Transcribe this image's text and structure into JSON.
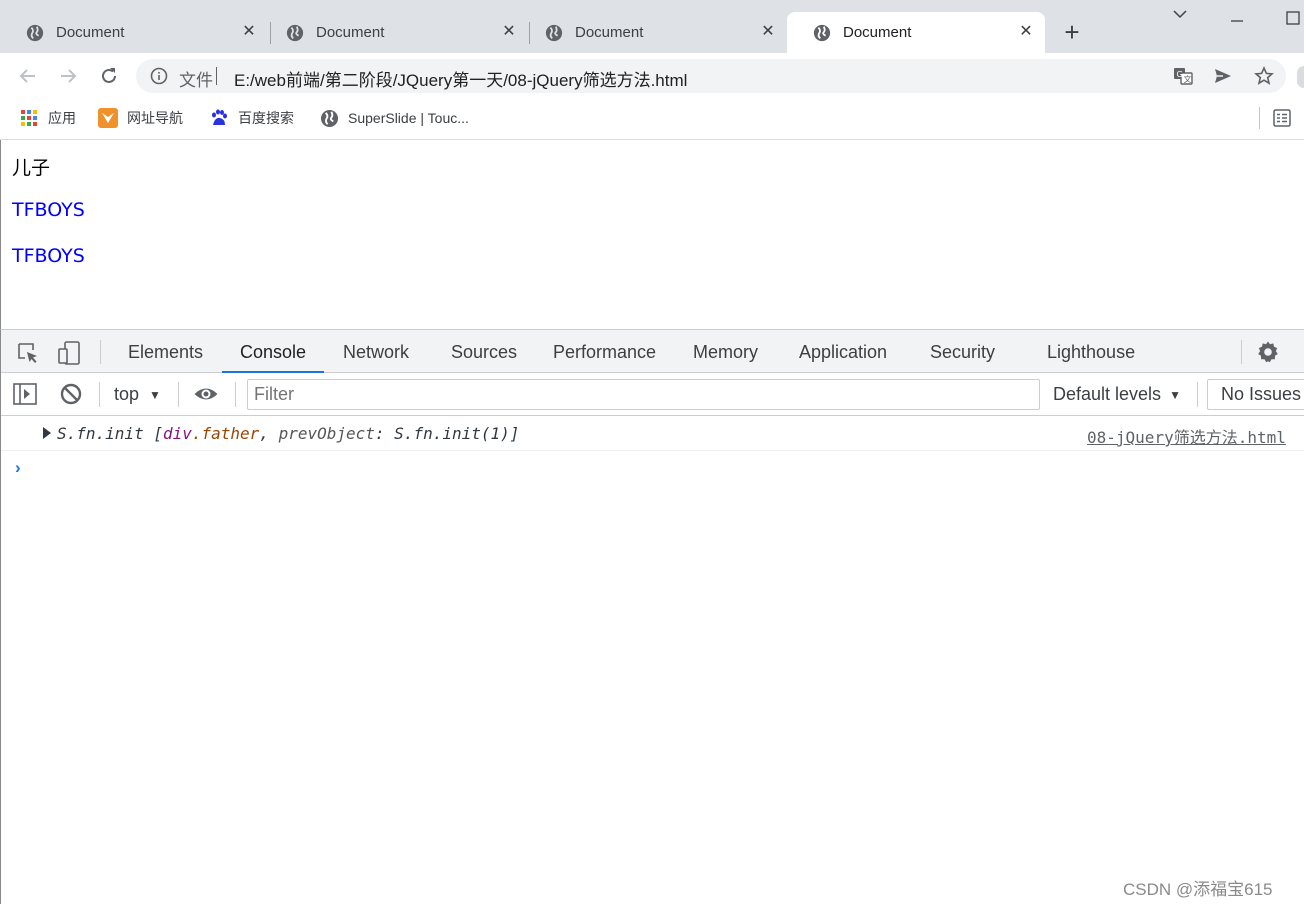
{
  "tabs": [
    {
      "title": "Document",
      "close": "✕",
      "active": false
    },
    {
      "title": "Document",
      "close": "✕",
      "active": false
    },
    {
      "title": "Document",
      "close": "✕",
      "active": false
    },
    {
      "title": "Document",
      "close": "✕",
      "active": true
    }
  ],
  "window": {
    "new_tab": "+",
    "dropdown": "⌵",
    "minimize": "—",
    "maximize": "☐"
  },
  "omnibox": {
    "security_label": "文件",
    "url": "E:/web前端/第二阶段/JQuery第一天/08-jQuery筛选方法.html"
  },
  "bookmarks": [
    {
      "label": "应用",
      "icon": "apps-grid-icon"
    },
    {
      "label": "网址导航",
      "icon": "nav-arrow-icon"
    },
    {
      "label": "百度搜索",
      "icon": "baidu-paw-icon"
    },
    {
      "label": "SuperSlide | Touc...",
      "icon": "globe-icon"
    }
  ],
  "page": {
    "paragraphs": [
      "儿子",
      "TFBOYS",
      "TFBOYS"
    ],
    "colors": {
      "default": "#000000",
      "highlight": "#0000ff"
    }
  },
  "devtools": {
    "tabs": [
      "Elements",
      "Console",
      "Network",
      "Sources",
      "Performance",
      "Memory",
      "Application",
      "Security",
      "Lighthouse"
    ],
    "active_tab": "Console",
    "context": "top",
    "filter_placeholder": "Filter",
    "levels": "Default levels",
    "issues": "No Issues",
    "accent": "#1a73e8"
  },
  "console": {
    "message": {
      "prefix": "S.fn.init [",
      "tag": "div",
      "cls": ".father",
      "sep": ", ",
      "key": "prevObject",
      "rest": ": S.fn.init(1)]",
      "source": "08-jQuery筛选方法.html"
    },
    "prompt": "›"
  },
  "watermark": "CSDN @添福宝615"
}
